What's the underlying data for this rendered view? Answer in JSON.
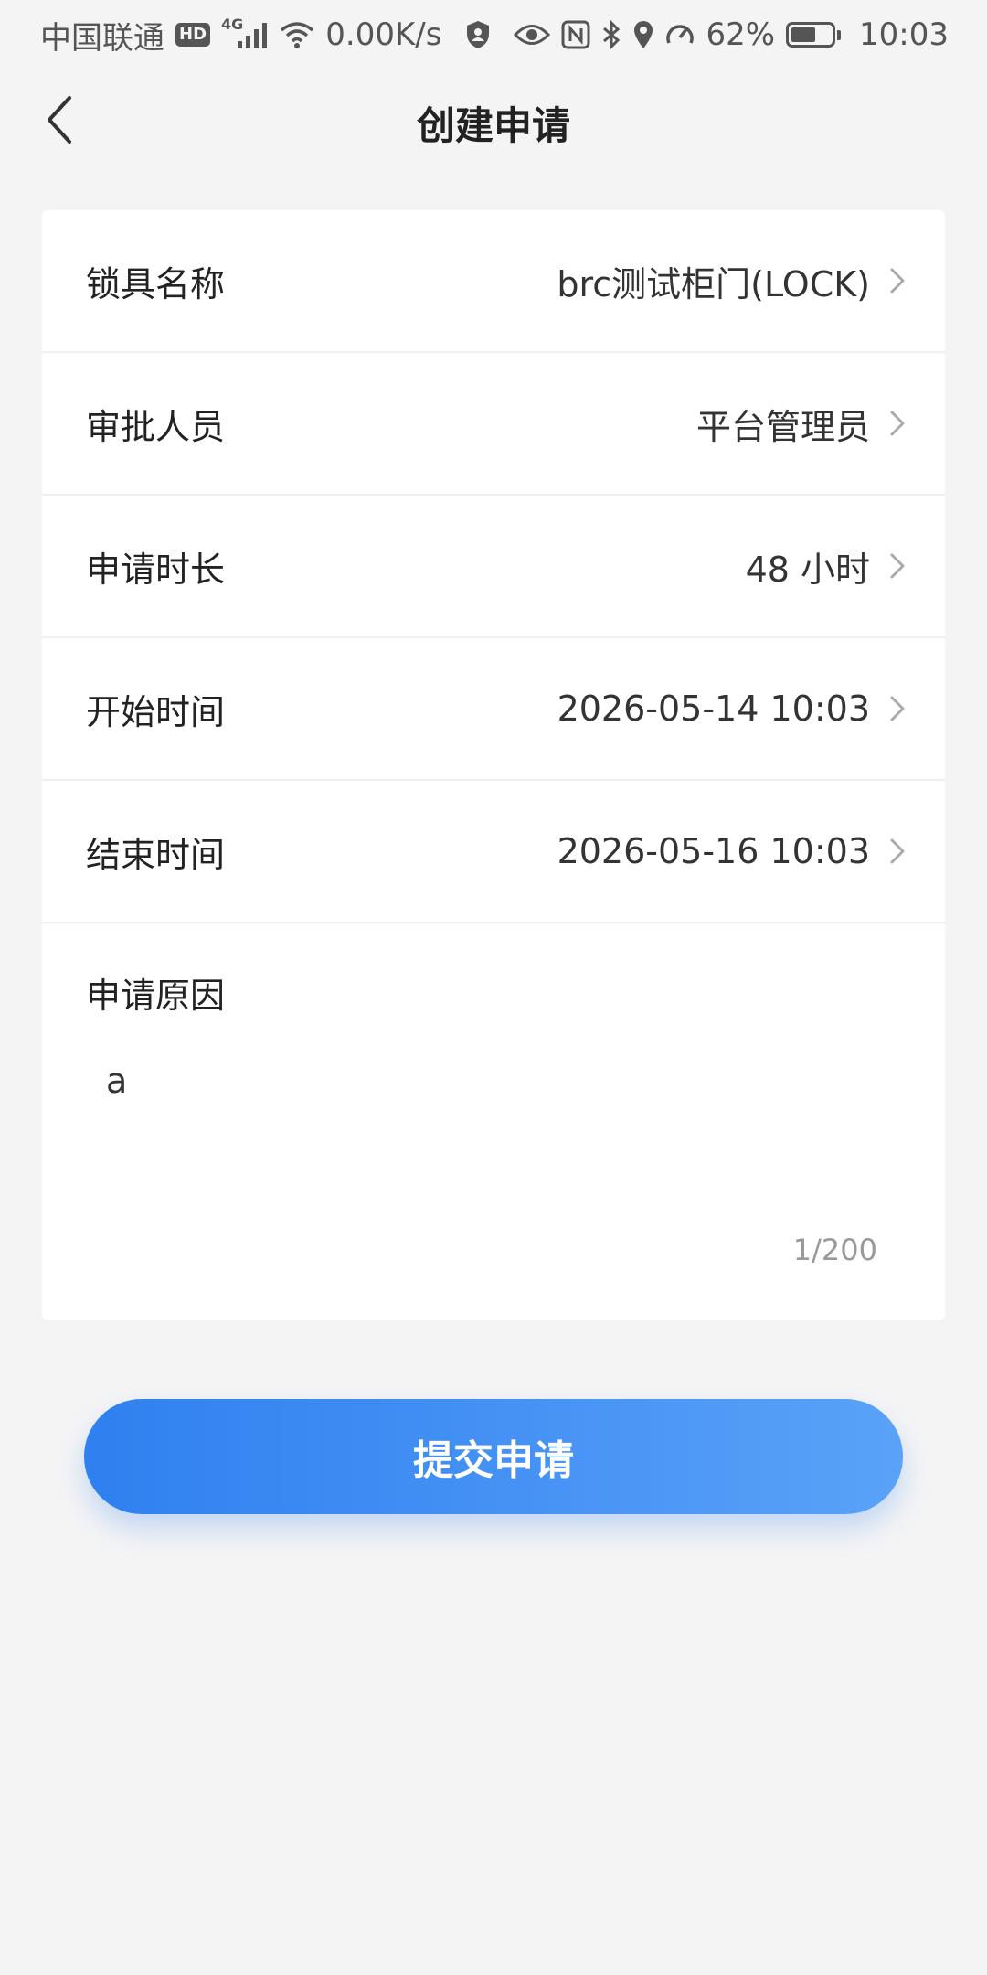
{
  "status_bar": {
    "carrier": "中国联通",
    "hd_badge": "HD",
    "network_type": "4G",
    "speed": "0.00K/s",
    "battery_percent": "62%",
    "battery_level": 0.62,
    "time": "10:03",
    "icons": [
      "hd-icon",
      "signal-icon",
      "wifi-icon",
      "shield-icon",
      "eye-icon",
      "nfc-icon",
      "bluetooth-icon",
      "location-icon",
      "speedometer-icon",
      "battery-icon"
    ]
  },
  "nav": {
    "back_icon": "chevron-left-icon",
    "title": "创建申请"
  },
  "form": {
    "rows": [
      {
        "label": "锁具名称",
        "value": "brc测试柜门(LOCK)"
      },
      {
        "label": "审批人员",
        "value": "平台管理员"
      },
      {
        "label": "申请时长",
        "value": "48 小时"
      },
      {
        "label": "开始时间",
        "value": "2026-05-14 10:03"
      },
      {
        "label": "结束时间",
        "value": "2026-05-16 10:03"
      }
    ],
    "reason": {
      "label": "申请原因",
      "value": "a",
      "counter": "1/200"
    }
  },
  "submit": {
    "label": "提交申请"
  },
  "colors": {
    "background": "#f4f4f5",
    "card": "#ffffff",
    "accent_start": "#2f80f0",
    "accent_end": "#5aa2f8",
    "text_primary": "#222222",
    "text_secondary": "#999999"
  }
}
